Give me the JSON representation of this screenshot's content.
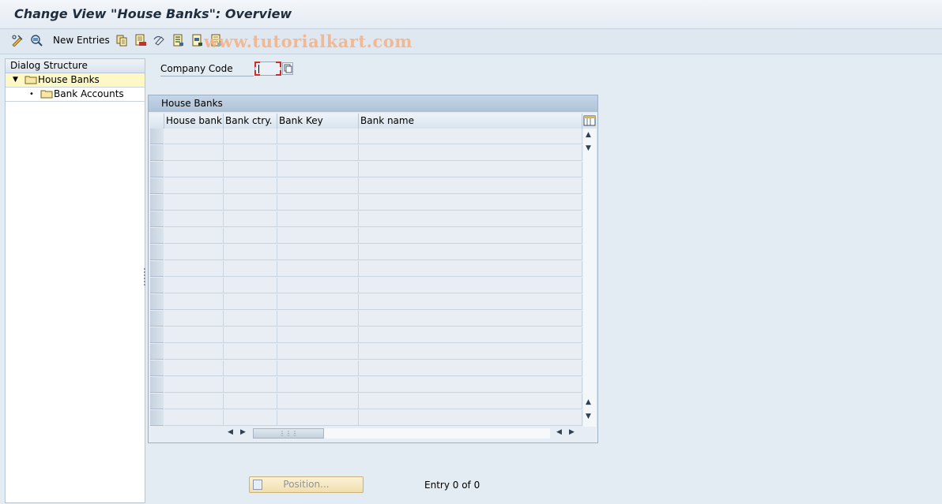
{
  "window": {
    "title": "Change View \"House Banks\": Overview"
  },
  "toolbar": {
    "new_entries_label": "New Entries",
    "icons": [
      "display-change-icon",
      "other-view-icon",
      "copy-icon",
      "delete-icon",
      "undo-change-icon",
      "select-all-icon",
      "select-block-icon",
      "deselect-all-icon"
    ]
  },
  "watermark": {
    "text": "www.tutorialkart.com"
  },
  "dialog_structure": {
    "header": "Dialog Structure",
    "items": [
      {
        "label": "House Banks",
        "selected": true,
        "expanded": true
      },
      {
        "label": "Bank Accounts",
        "selected": false
      }
    ]
  },
  "selection": {
    "company_code_label": "Company Code",
    "company_code_value": ""
  },
  "table": {
    "title": "House Banks",
    "columns": [
      "House bank",
      "Bank ctry.",
      "Bank Key",
      "Bank name"
    ],
    "rows": []
  },
  "footer": {
    "position_button_label": "Position...",
    "entry_text": "Entry 0 of 0"
  },
  "colors": {
    "background": "#e3ebf3",
    "selected_tree_item": "#fdf8c6",
    "table_header": "#aec3d8",
    "required_marker": "#d12b2b"
  }
}
